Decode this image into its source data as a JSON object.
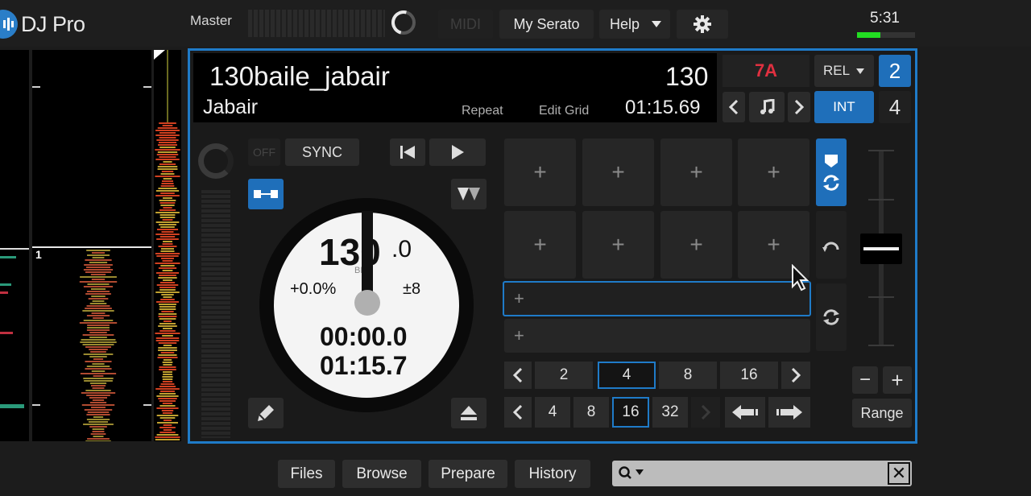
{
  "app": {
    "logo": "DJ Pro"
  },
  "topbar": {
    "master_label": "Master",
    "midi_label": "MIDI",
    "my_serato_label": "My Serato",
    "help_label": "Help",
    "clock": "5:31",
    "battery_level": 0.4
  },
  "overview": {
    "marker": "1"
  },
  "deck": {
    "number_top": "2",
    "number_bottom": "4",
    "track_title": "130baile_jabair",
    "artist": "Jabair",
    "bpm": "130",
    "elapsed": "01:15.69",
    "repeat_label": "Repeat",
    "edit_grid_label": "Edit Grid",
    "key": "7A",
    "rel_label": "REL",
    "int_label": "INT",
    "off_label": "OFF",
    "sync_label": "SYNC",
    "platter": {
      "bpm_int": "130",
      "bpm_dec": ".0",
      "bpm_label": "BPM",
      "pitch": "+0.0%",
      "range": "±8",
      "time_elapsed": "00:00.0",
      "time_remaining": "01:15.7"
    },
    "pad_plus": "+",
    "loop_lengths": [
      "2",
      "4",
      "8",
      "16"
    ],
    "loop_selected": "4",
    "beatjump_lengths": [
      "4",
      "8",
      "16",
      "32"
    ],
    "beatjump_selected": "16",
    "range_label": "Range",
    "minus_label": "−",
    "plus_label": "+"
  },
  "bottom": {
    "files_label": "Files",
    "browse_label": "Browse",
    "prepare_label": "Prepare",
    "history_label": "History",
    "search_placeholder": "",
    "close_label": "✕"
  },
  "colors": {
    "accent": "#1f7bc8",
    "key": "#e03040",
    "battery": "#22dd22"
  }
}
